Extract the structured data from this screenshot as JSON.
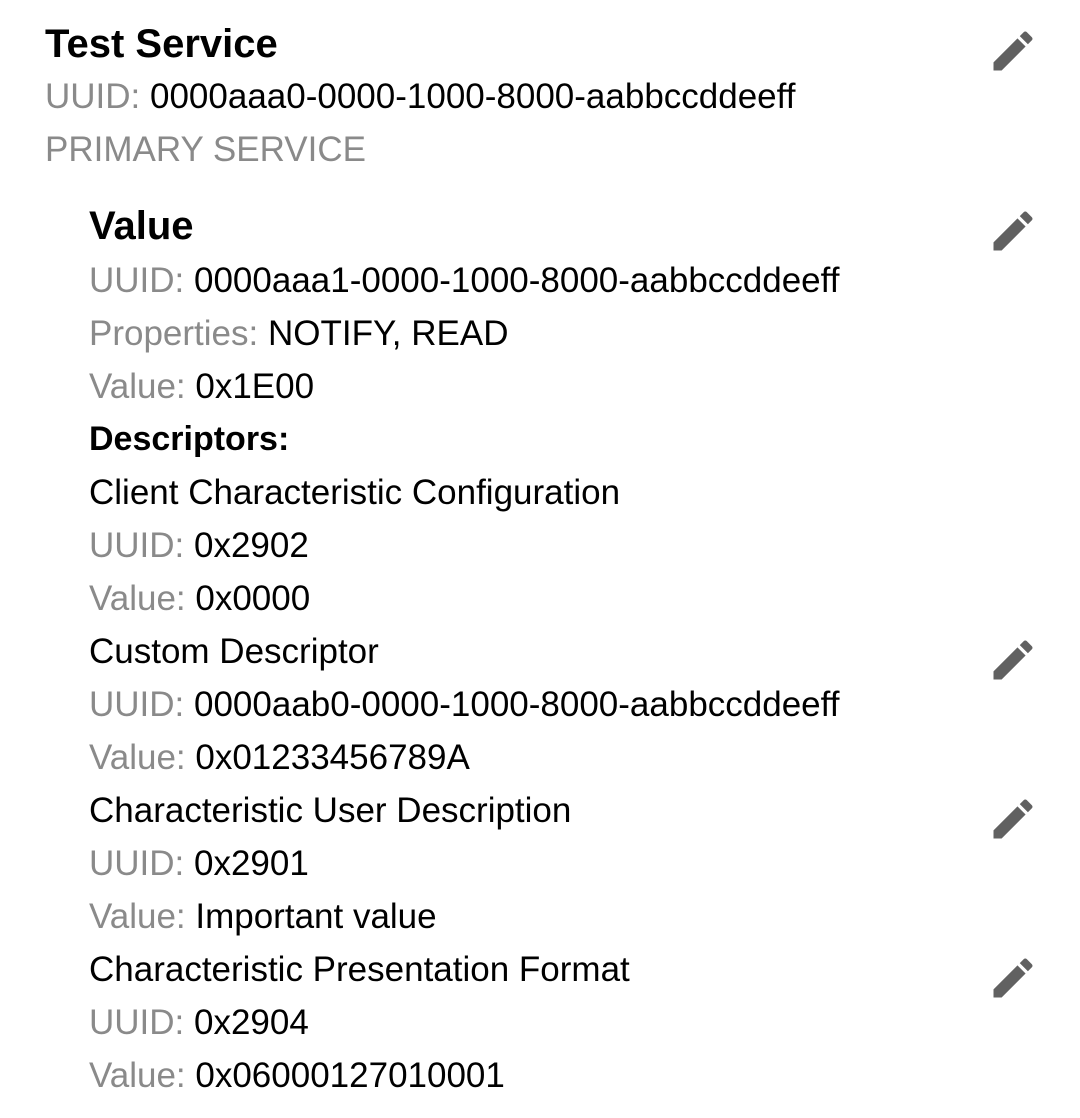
{
  "service": {
    "name": "Test Service",
    "uuid_label": "UUID: ",
    "uuid": "0000aaa0-0000-1000-8000-aabbccddeeff",
    "type": "PRIMARY SERVICE",
    "edit_icon": "pencil-icon"
  },
  "characteristic": {
    "name": "Value",
    "uuid_label": "UUID: ",
    "uuid": "0000aaa1-0000-1000-8000-aabbccddeeff",
    "properties_label": "Properties: ",
    "properties": "NOTIFY, READ",
    "value_label": "Value: ",
    "value": "0x1E00",
    "edit_icon": "pencil-icon",
    "descriptors_heading": "Descriptors:",
    "descriptors": [
      {
        "name": "Client Characteristic Configuration",
        "uuid_label": "UUID: ",
        "uuid": "0x2902",
        "value_label": "Value: ",
        "value": "0x0000"
      },
      {
        "name": "Custom Descriptor",
        "uuid_label": "UUID: ",
        "uuid": "0000aab0-0000-1000-8000-aabbccddeeff",
        "value_label": "Value: ",
        "value": "0x01233456789A",
        "edit_icon": "pencil-icon"
      },
      {
        "name": "Characteristic User Description",
        "uuid_label": "UUID: ",
        "uuid": "0x2901",
        "value_label": "Value: ",
        "value": "Important value",
        "edit_icon": "pencil-icon"
      },
      {
        "name": "Characteristic Presentation Format",
        "uuid_label": "UUID: ",
        "uuid": "0x2904",
        "value_label": "Value: ",
        "value": "0x06000127010001",
        "edit_icon": "pencil-icon"
      }
    ]
  },
  "colors": {
    "label": "#8a8a8a",
    "text": "#000000",
    "icon": "#616161"
  }
}
